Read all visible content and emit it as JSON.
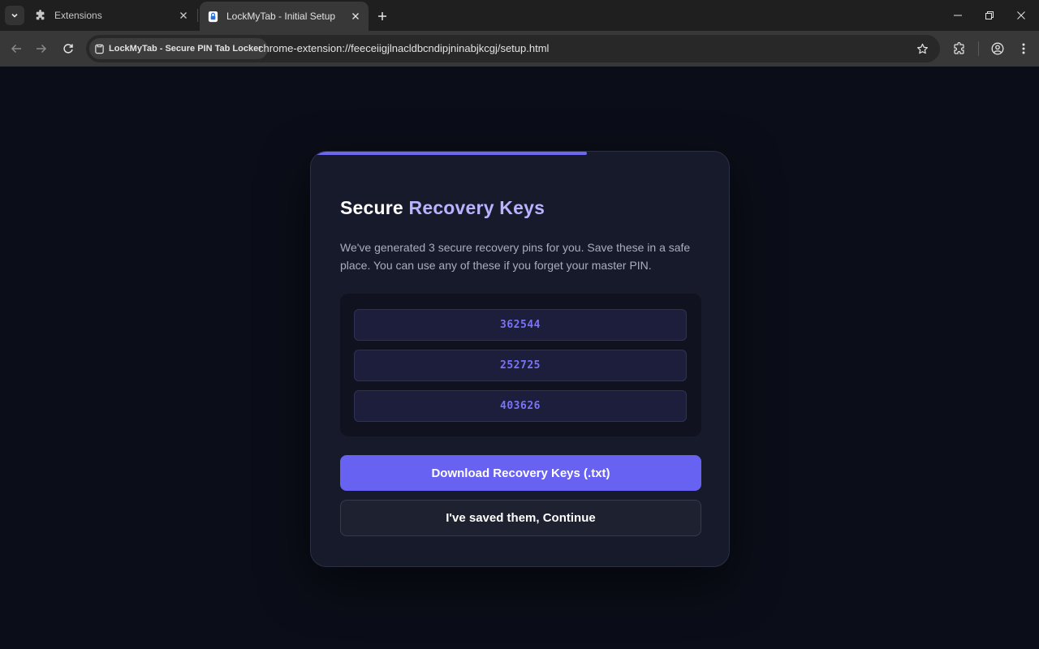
{
  "browser": {
    "tabs": [
      {
        "title": "Extensions",
        "icon": "puzzle-icon",
        "active": false
      },
      {
        "title": "LockMyTab - Initial Setup",
        "icon": "lock-icon",
        "active": true
      }
    ],
    "site_chip": "LockMyTab - Secure PIN Tab Locker",
    "url": "chrome-extension://feeceiigjlnacldbcndipjninabjkcgj/setup.html"
  },
  "setup": {
    "progress": 0.66,
    "title_part1": "Secure",
    "title_part2": "Recovery Keys",
    "description": "We've generated 3 secure recovery pins for you. Save these in a safe place. You can use any of these if you forget your master PIN.",
    "keys": [
      "362544",
      "252725",
      "403626"
    ],
    "download_label": "Download Recovery Keys (.txt)",
    "continue_label": "I've saved them, Continue"
  },
  "colors": {
    "accent": "#6762f2",
    "page_bg": "#0b0e18",
    "card_bg": "#161a2a",
    "key_text": "#7a73f5"
  }
}
